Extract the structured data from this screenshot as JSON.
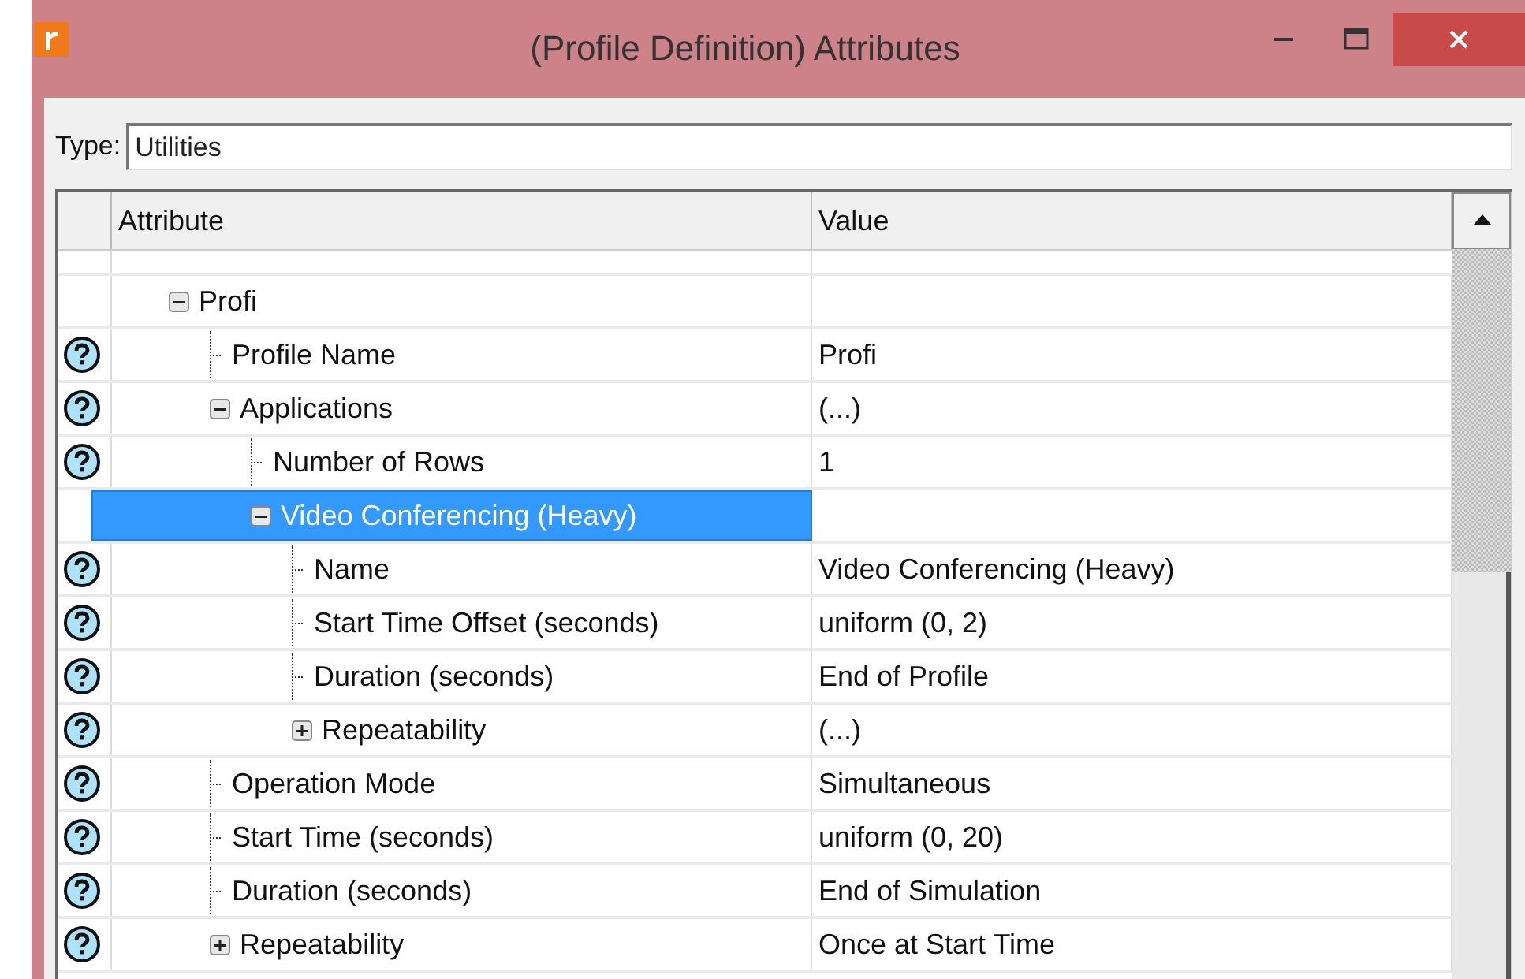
{
  "window": {
    "title": "(Profile Definition) Attributes"
  },
  "type_field": {
    "label": "Type:",
    "value": "Utilities"
  },
  "table": {
    "columns": [
      "Attribute",
      "Value"
    ],
    "rows": [
      {
        "kind": "group",
        "label": "Profi",
        "help": false,
        "expanded": true,
        "selected": false,
        "children": [
          {
            "kind": "leaf",
            "label": "Profile Name",
            "value": "Profi",
            "help": true,
            "selected": false
          },
          {
            "kind": "group",
            "label": "Applications",
            "value": "(...)",
            "help": true,
            "expanded": true,
            "selected": false,
            "children": [
              {
                "kind": "leaf",
                "label": "Number of Rows",
                "value": "1",
                "help": true,
                "selected": false
              },
              {
                "kind": "group",
                "label": "Video Conferencing (Heavy)",
                "help": false,
                "expanded": true,
                "selected": true,
                "children": [
                  {
                    "kind": "leaf",
                    "label": "Name",
                    "value": "Video Conferencing (Heavy)",
                    "help": true,
                    "selected": false
                  },
                  {
                    "kind": "leaf",
                    "label": "Start Time Offset (seconds)",
                    "value": "uniform (0, 2)",
                    "help": true,
                    "selected": false
                  },
                  {
                    "kind": "leaf",
                    "label": "Duration (seconds)",
                    "value": "End of Profile",
                    "help": true,
                    "selected": false
                  },
                  {
                    "kind": "group",
                    "label": "Repeatability",
                    "value": "(...)",
                    "help": true,
                    "expanded": false,
                    "selected": false
                  }
                ]
              }
            ]
          },
          {
            "kind": "leaf",
            "label": "Operation Mode",
            "value": "Simultaneous",
            "help": true,
            "selected": false
          },
          {
            "kind": "leaf",
            "label": "Start Time (seconds)",
            "value": "uniform (0, 20)",
            "help": true,
            "selected": false
          },
          {
            "kind": "leaf",
            "label": "Duration (seconds)",
            "value": "End of Simulation",
            "help": true,
            "selected": false
          },
          {
            "kind": "group",
            "label": "Repeatability",
            "value": "Once at Start Time",
            "help": true,
            "expanded": false,
            "selected": false
          }
        ]
      }
    ]
  }
}
